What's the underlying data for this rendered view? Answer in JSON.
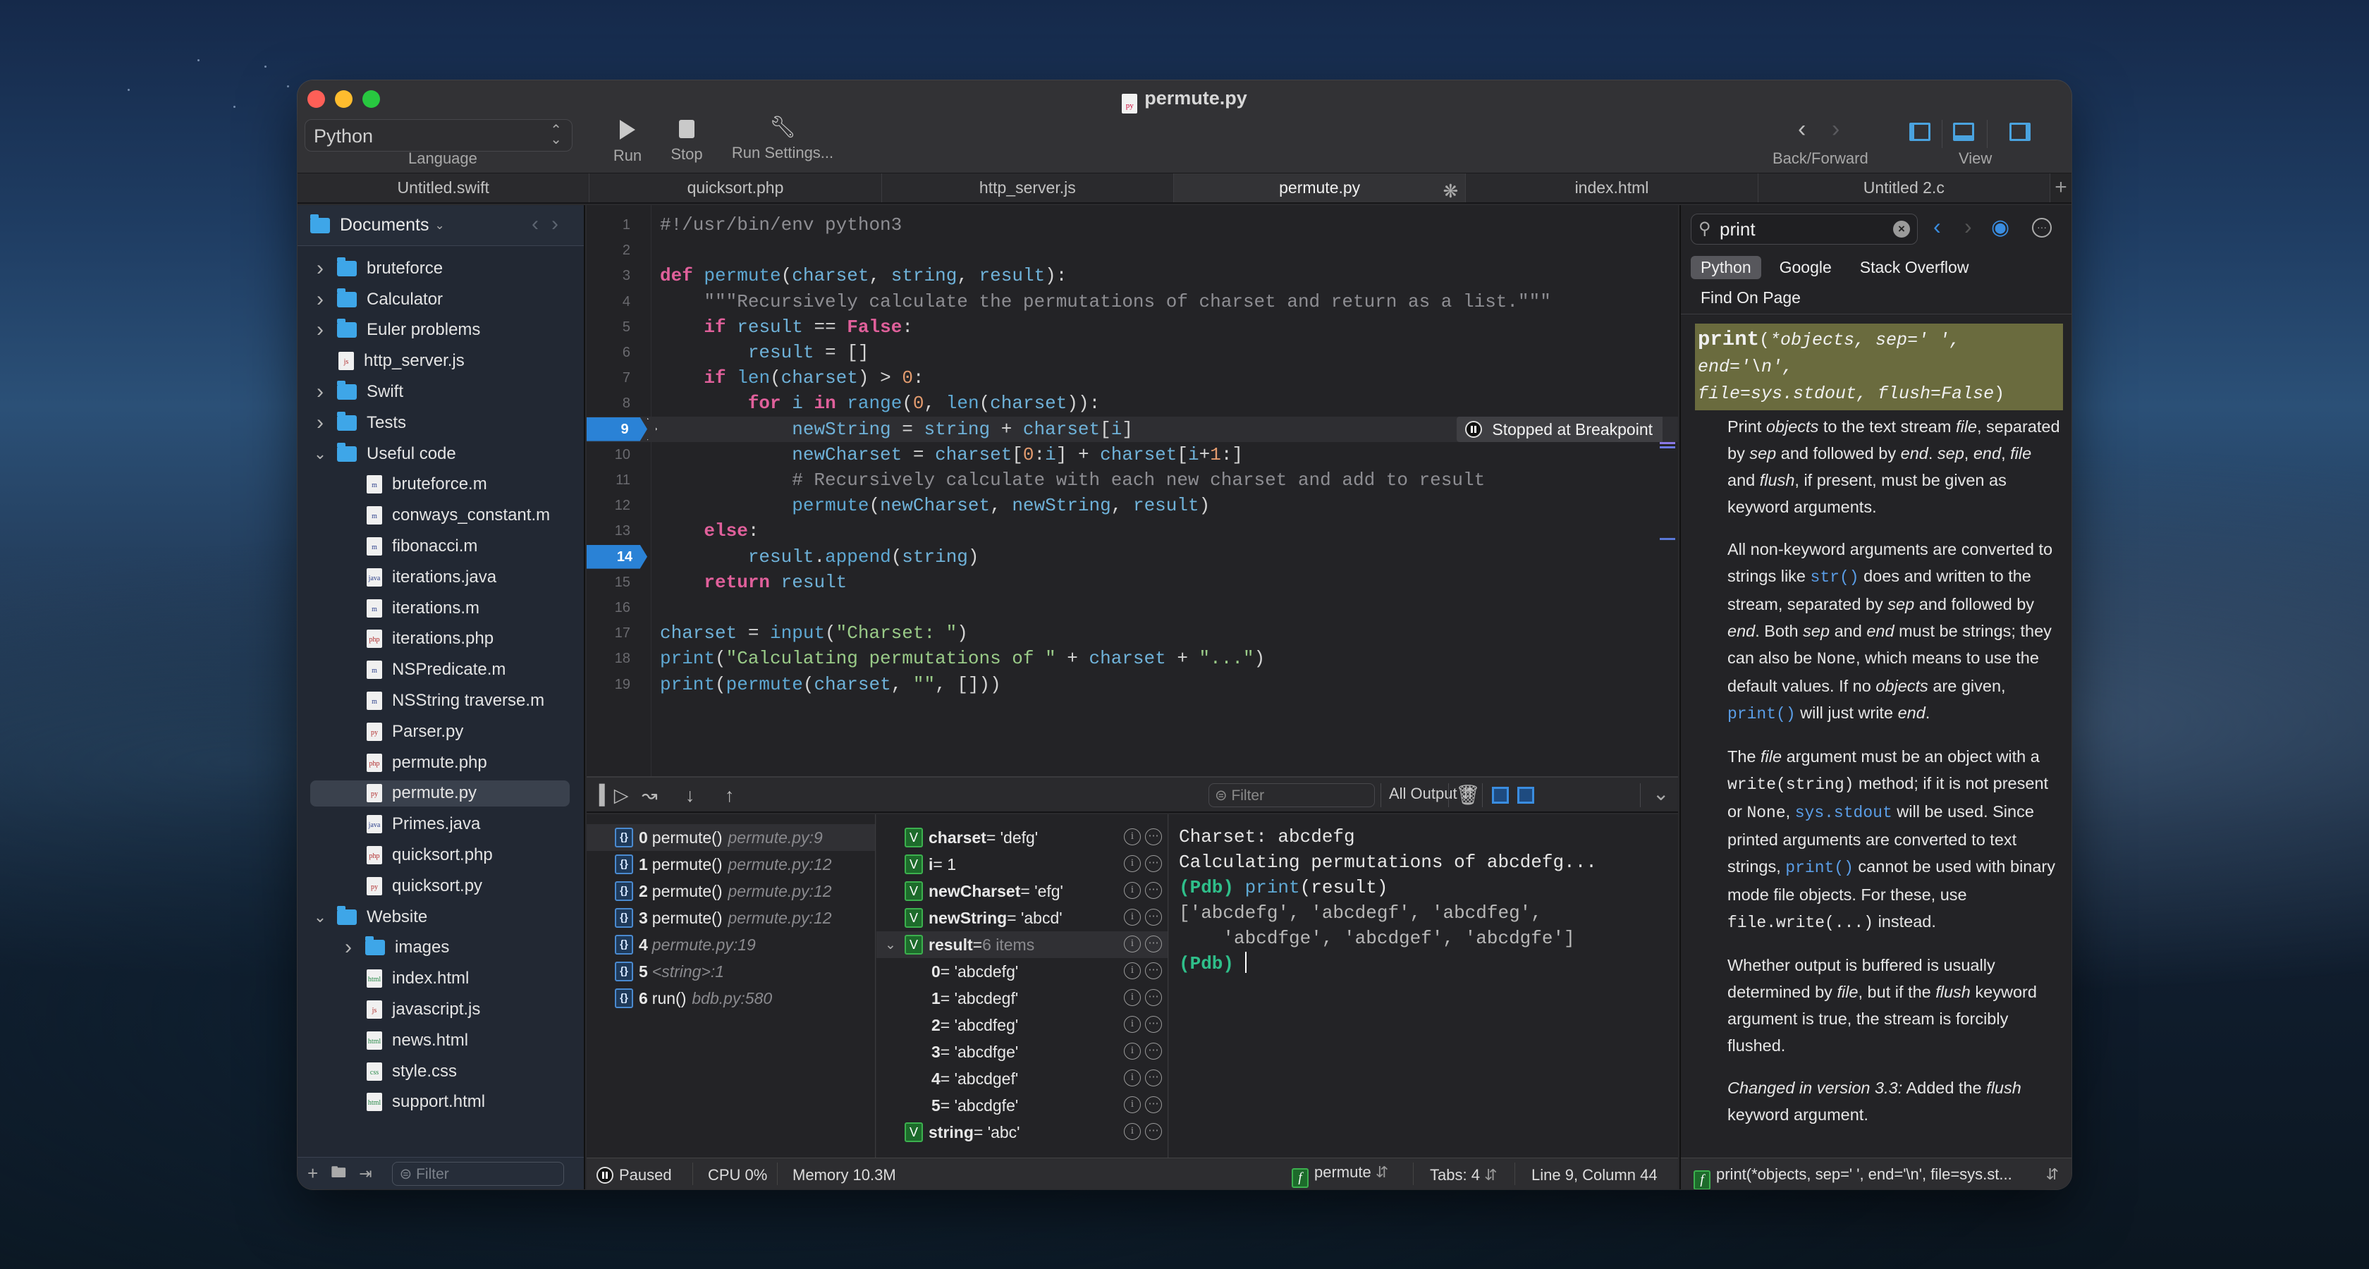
{
  "window": {
    "title": "permute.py",
    "title_icon": "python-file-icon"
  },
  "toolbar": {
    "language_value": "Python",
    "language_label": "Language",
    "run_label": "Run",
    "stop_label": "Stop",
    "run_settings_label": "Run Settings...",
    "back_forward_label": "Back/Forward",
    "view_label": "View"
  },
  "tabs": [
    {
      "label": "Untitled.swift",
      "active": false
    },
    {
      "label": "quicksort.php",
      "active": false
    },
    {
      "label": "http_server.js",
      "active": false
    },
    {
      "label": "permute.py",
      "active": true,
      "loading": true
    },
    {
      "label": "index.html",
      "active": false
    },
    {
      "label": "Untitled 2.c",
      "active": false
    }
  ],
  "sidebar": {
    "root_label": "Documents",
    "filter_placeholder": "Filter",
    "items": [
      {
        "label": "bruteforce",
        "type": "folder",
        "depth": 0,
        "expanded": false
      },
      {
        "label": "Calculator",
        "type": "folder",
        "depth": 0,
        "expanded": false
      },
      {
        "label": "Euler problems",
        "type": "folder",
        "depth": 0,
        "expanded": false
      },
      {
        "label": "http_server.js",
        "type": "file",
        "ext": "js",
        "depth": 0
      },
      {
        "label": "Swift",
        "type": "folder",
        "depth": 0,
        "expanded": false
      },
      {
        "label": "Tests",
        "type": "folder",
        "depth": 0,
        "expanded": false
      },
      {
        "label": "Useful code",
        "type": "folder",
        "depth": 0,
        "expanded": true
      },
      {
        "label": "bruteforce.m",
        "type": "file",
        "ext": "m",
        "depth": 1
      },
      {
        "label": "conways_constant.m",
        "type": "file",
        "ext": "m",
        "depth": 1
      },
      {
        "label": "fibonacci.m",
        "type": "file",
        "ext": "m",
        "depth": 1
      },
      {
        "label": "iterations.java",
        "type": "file",
        "ext": "java",
        "depth": 1
      },
      {
        "label": "iterations.m",
        "type": "file",
        "ext": "m",
        "depth": 1
      },
      {
        "label": "iterations.php",
        "type": "file",
        "ext": "php",
        "depth": 1
      },
      {
        "label": "NSPredicate.m",
        "type": "file",
        "ext": "m",
        "depth": 1
      },
      {
        "label": "NSString traverse.m",
        "type": "file",
        "ext": "m",
        "depth": 1
      },
      {
        "label": "Parser.py",
        "type": "file",
        "ext": "py",
        "depth": 1
      },
      {
        "label": "permute.php",
        "type": "file",
        "ext": "php",
        "depth": 1
      },
      {
        "label": "permute.py",
        "type": "file",
        "ext": "py",
        "depth": 1,
        "selected": true
      },
      {
        "label": "Primes.java",
        "type": "file",
        "ext": "java",
        "depth": 1
      },
      {
        "label": "quicksort.php",
        "type": "file",
        "ext": "php",
        "depth": 1
      },
      {
        "label": "quicksort.py",
        "type": "file",
        "ext": "py",
        "depth": 1
      },
      {
        "label": "Website",
        "type": "folder",
        "depth": 0,
        "expanded": true
      },
      {
        "label": "images",
        "type": "folder",
        "depth": 1,
        "expanded": false
      },
      {
        "label": "index.html",
        "type": "file",
        "ext": "html",
        "depth": 1
      },
      {
        "label": "javascript.js",
        "type": "file",
        "ext": "js",
        "depth": 1
      },
      {
        "label": "news.html",
        "type": "file",
        "ext": "html",
        "depth": 1
      },
      {
        "label": "style.css",
        "type": "file",
        "ext": "css",
        "depth": 1
      },
      {
        "label": "support.html",
        "type": "file",
        "ext": "html",
        "depth": 1
      }
    ]
  },
  "editor": {
    "current_line": 9,
    "breakpoints": [
      9,
      14
    ],
    "breakpoint_badge": "Stopped at Breakpoint",
    "lines": [
      "#!/usr/bin/env python3",
      "",
      "def permute(charset, string, result):",
      "    \"\"\"Recursively calculate the permutations of charset and return as a list.\"\"\"",
      "    if result == False:",
      "        result = []",
      "    if len(charset) > 0:",
      "        for i in range(0, len(charset)):",
      "            newString = string + charset[i]",
      "            newCharset = charset[0:i] + charset[i+1:]",
      "            # Recursively calculate with each new charset and add to result",
      "            permute(newCharset, newString, result)",
      "    else:",
      "        result.append(string)",
      "    return result",
      "",
      "charset = input(\"Charset: \")",
      "print(\"Calculating permutations of \" + charset + \"...\")",
      "print(permute(charset, \"\", []))"
    ]
  },
  "debugger": {
    "filter_placeholder": "Filter",
    "output_select": "All Output",
    "stack": [
      {
        "index": "0",
        "func": "permute()",
        "loc": "permute.py:9",
        "selected": true
      },
      {
        "index": "1",
        "func": "permute()",
        "loc": "permute.py:12"
      },
      {
        "index": "2",
        "func": "permute()",
        "loc": "permute.py:12"
      },
      {
        "index": "3",
        "func": "permute()",
        "loc": "permute.py:12"
      },
      {
        "index": "4",
        "func": "",
        "loc": "permute.py:19"
      },
      {
        "index": "5",
        "func": "",
        "loc": "<string>:1"
      },
      {
        "index": "6",
        "func": "run()",
        "loc": "bdb.py:580"
      }
    ],
    "variables": [
      {
        "name": "charset",
        "value": " = 'defg'",
        "badge": true
      },
      {
        "name": "i",
        "value": " = 1",
        "badge": true
      },
      {
        "name": "newCharset",
        "value": " = 'efg'",
        "badge": true
      },
      {
        "name": "newString",
        "value": " = 'abcd'",
        "badge": true
      },
      {
        "name": "result",
        "value": " = ",
        "count": "6 items",
        "badge": true,
        "expanded": true,
        "selected": true
      },
      {
        "name": "0",
        "value": " = 'abcdefg'",
        "child": true
      },
      {
        "name": "1",
        "value": " = 'abcdegf'",
        "child": true
      },
      {
        "name": "2",
        "value": " = 'abcdfeg'",
        "child": true
      },
      {
        "name": "3",
        "value": " = 'abcdfge'",
        "child": true
      },
      {
        "name": "4",
        "value": " = 'abcdgef'",
        "child": true
      },
      {
        "name": "5",
        "value": " = 'abcdgfe'",
        "child": true
      },
      {
        "name": "string",
        "value": " = 'abc'",
        "badge": true
      }
    ],
    "console": {
      "line1": "Charset: abcdefg",
      "line2": "Calculating permutations of abcdefg...",
      "prompt": "(Pdb)",
      "cmd_func": "print",
      "cmd_rest": "(result)",
      "result_line1": "['abcdefg', 'abcdegf', 'abcdfeg',",
      "result_line2": "    'abcdfge', 'abcdgef', 'abcdgfe']"
    }
  },
  "status": {
    "state": "Paused",
    "cpu": "CPU 0%",
    "memory": "Memory 10.3M",
    "function": "permute",
    "tabs": "Tabs: 4",
    "position": "Line 9, Column 44"
  },
  "docs": {
    "search_value": "print",
    "scopes": [
      "Python",
      "Google",
      "Stack Overflow",
      "Find On Page"
    ],
    "active_scope": "Python",
    "signature_name": "print",
    "signature_args_1": "*objects, sep=' ', end='\\n',",
    "signature_args_2": "file=sys.stdout, flush=False",
    "status_signature": "print(*objects, sep=' ', end='\\n', file=sys.st...",
    "accent_color": "#3a8de0"
  }
}
